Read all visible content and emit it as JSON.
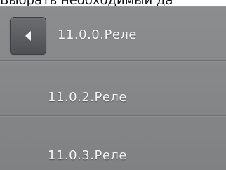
{
  "header": {
    "instruction": "Выбрать необходимый да"
  },
  "menu": {
    "back_icon": "triangle-left-icon",
    "items": [
      {
        "label": "11.0.0.Реле",
        "active": true
      },
      {
        "label": "11.0.2.Реле"
      },
      {
        "label": "11.0.3.Реле"
      }
    ]
  },
  "colors": {
    "panel": "#858688",
    "divider": "#6f7072",
    "text": "#f3f3f3",
    "button": "#5a5b5e"
  }
}
